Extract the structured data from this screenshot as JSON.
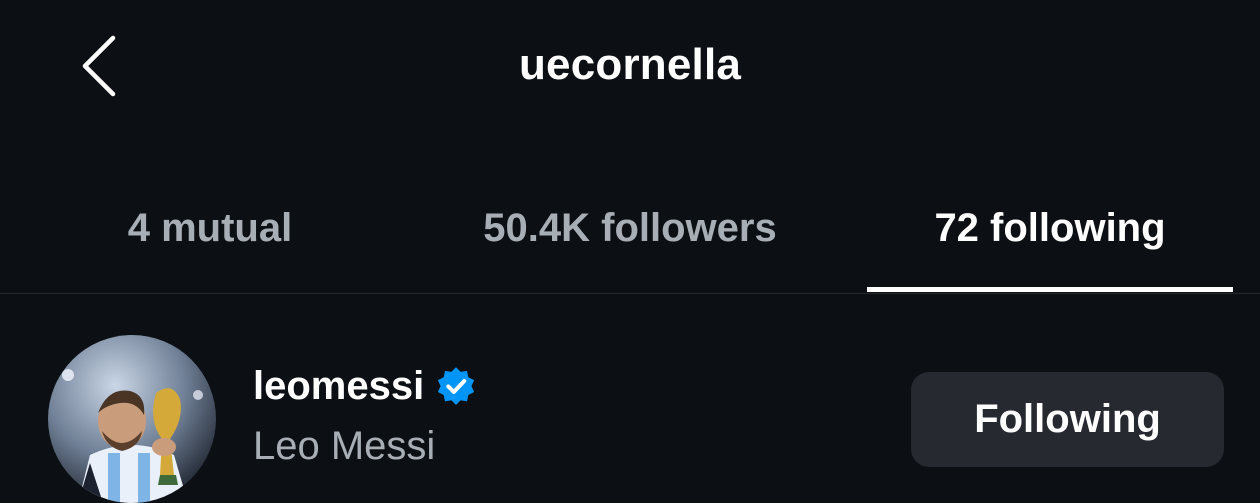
{
  "header": {
    "title": "uecornella",
    "back_icon": "chevron-left-icon"
  },
  "tabs": [
    {
      "label": "4 mutual",
      "active": false
    },
    {
      "label": "50.4K followers",
      "active": false
    },
    {
      "label": "72 following",
      "active": true
    }
  ],
  "list": {
    "items": [
      {
        "username": "leomessi",
        "full_name": "Leo Messi",
        "verified": true,
        "verified_icon": "verified-badge-icon",
        "avatar_icon": "profile-photo",
        "button_label": "Following"
      }
    ]
  },
  "colors": {
    "background": "#0c1014",
    "text_primary": "#ffffff",
    "text_secondary": "#a8aeb5",
    "verified_blue": "#0095f6",
    "button_bg": "#262a30"
  }
}
